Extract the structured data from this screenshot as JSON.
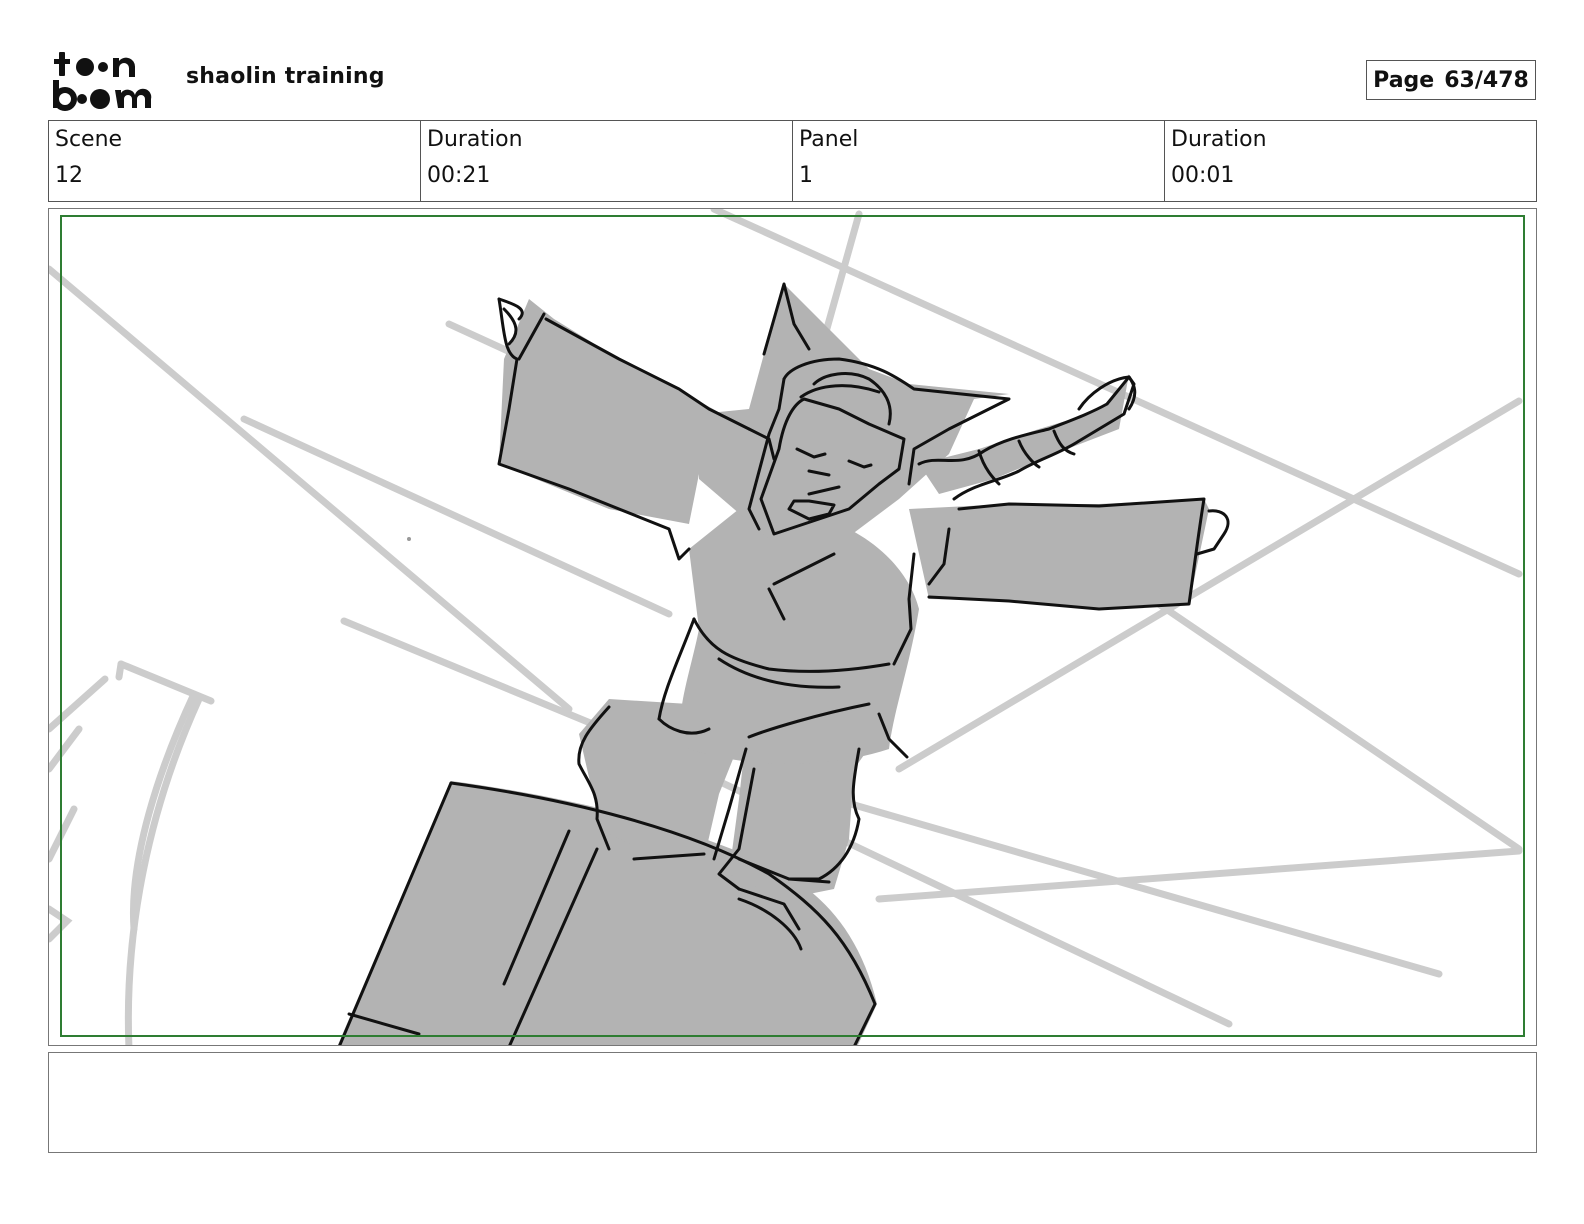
{
  "header": {
    "logo": {
      "icon": "toonboom-logo",
      "text": "toon boom"
    },
    "project_title": "shaolin training",
    "page_label": "Page",
    "page_value": "63/478"
  },
  "info": {
    "scene_label": "Scene",
    "scene_value": "12",
    "scene_duration_label": "Duration",
    "scene_duration_value": "00:21",
    "panel_label": "Panel",
    "panel_value": "1",
    "panel_duration_label": "Duration",
    "panel_duration_value": "00:01"
  },
  "panel": {
    "image": "storyboard-sketch-monk-jumping",
    "safe_frame_color": "#2e7d32",
    "fill_color": "#b3b3b3",
    "guide_color": "#cccccc"
  },
  "notes": {
    "text": ""
  }
}
